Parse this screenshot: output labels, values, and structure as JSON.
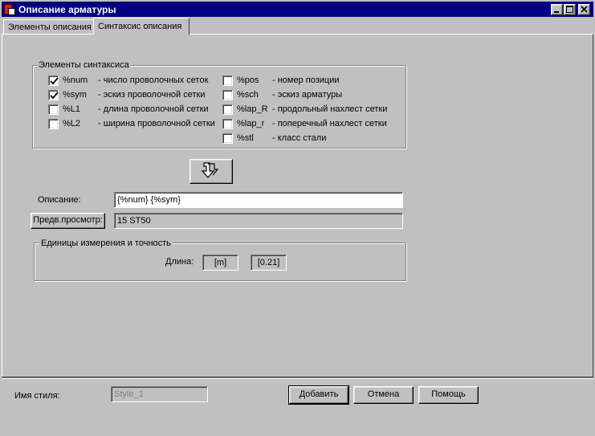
{
  "window": {
    "title": "Описание арматуры"
  },
  "tabs": [
    {
      "label": "Элементы описания"
    },
    {
      "label": "Синтаксис описания"
    }
  ],
  "syntax_group": {
    "title": "Элементы синтаксиса",
    "left_items": [
      {
        "code": "%num",
        "desc": "- число проволочных сеток",
        "checked": true
      },
      {
        "code": "%sym",
        "desc": "- эскиз проволочной сетки",
        "checked": true
      },
      {
        "code": "%L1",
        "desc": "- длина проволочной сетки",
        "checked": false
      },
      {
        "code": "%L2",
        "desc": "- ширина проволочной сетки",
        "checked": false
      }
    ],
    "right_items": [
      {
        "code": "%pos",
        "desc": "- номер позиции",
        "checked": false
      },
      {
        "code": "%sch",
        "desc": "- эскиз арматуры",
        "checked": false
      },
      {
        "code": "%lap_R",
        "desc": "- продольный нахлест сетки",
        "checked": false
      },
      {
        "code": "%lap_r",
        "desc": "- поперечный нахлест сетки",
        "checked": false
      },
      {
        "code": "%stl",
        "desc": "- класс стали",
        "checked": false
      }
    ]
  },
  "description": {
    "label": "Описание:",
    "value": "{%num} {%sym}"
  },
  "preview": {
    "button_label": "Предв.просмотр:",
    "value": "15 ST50"
  },
  "units_group": {
    "title": "Единицы измерения и точность",
    "length_label": "Длина:",
    "unit": "[m]",
    "precision": "[0.21]"
  },
  "footer": {
    "style_name_label": "Имя стиля:",
    "style_name_value": "Style_1",
    "add_button": "Добавить",
    "cancel_button": "Отмена",
    "help_button": "Помощь"
  }
}
